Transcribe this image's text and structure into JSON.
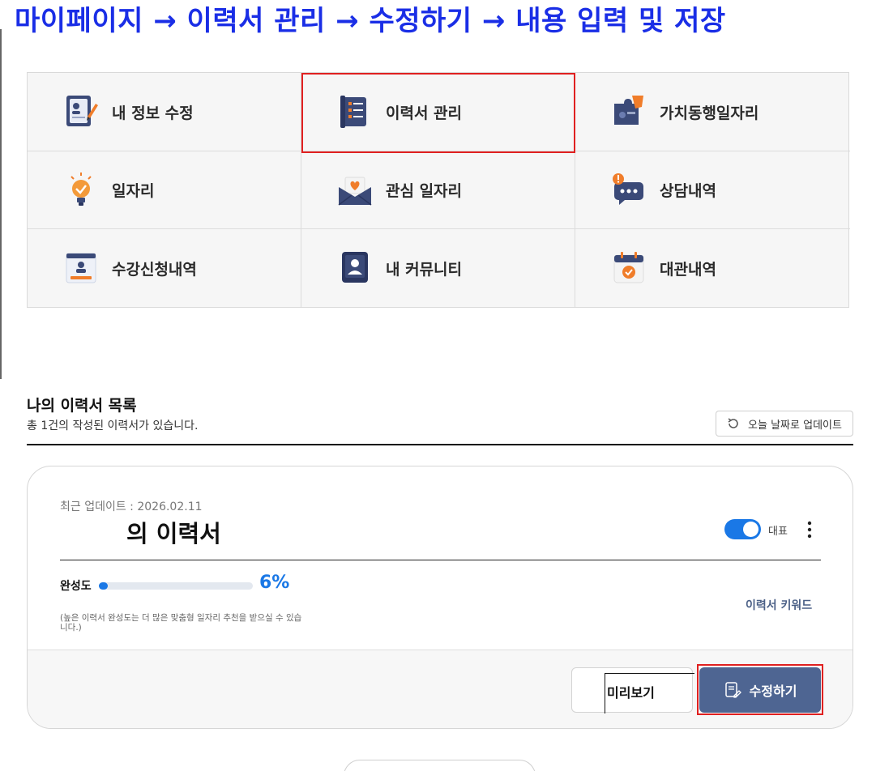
{
  "banner": {
    "text": "마이페이지 → 이력서 관리 → 수정하기 → 내용 입력 및 저장",
    "color": "#1a2ee6"
  },
  "menu": {
    "items": [
      {
        "label": "내 정보 수정",
        "icon": "profile-edit-icon"
      },
      {
        "label": "이력서 관리",
        "icon": "resume-icon"
      },
      {
        "label": "가치동행일자리",
        "icon": "puzzle-icon"
      },
      {
        "label": "일자리",
        "icon": "lightbulb-icon"
      },
      {
        "label": "관심 일자리",
        "icon": "heart-envelope-icon"
      },
      {
        "label": "상담내역",
        "icon": "chat-icon"
      },
      {
        "label": "수강신청내역",
        "icon": "id-card-icon"
      },
      {
        "label": "내 커뮤니티",
        "icon": "user-card-icon"
      },
      {
        "label": "대관내역",
        "icon": "calendar-check-icon"
      }
    ],
    "highlighted_item": "이력서 관리"
  },
  "resume_list": {
    "title": "나의 이력서 목록",
    "subtitle": "총 1건의 작성된 이력서가 있습니다.",
    "update_button": "오늘 날짜로 업데이트"
  },
  "card": {
    "updated": "최근 업데이트 : 2026.02.11",
    "title": "의 이력서",
    "representative_label": "대표",
    "representative_on": true,
    "progress_label": "완성도",
    "progress_value": 6,
    "progress_text": "6%",
    "note": "(높은 이력서 완성도는 더 많은 맞춤형 일자리 추천을 받으실 수 있습니다.)",
    "keyword_link": "이력서 키워드",
    "preview_button": "미리보기",
    "edit_button": "수정하기"
  },
  "colors": {
    "accent": "#1a78e6",
    "edit_button": "#4e6592",
    "highlight": "#e02020"
  }
}
